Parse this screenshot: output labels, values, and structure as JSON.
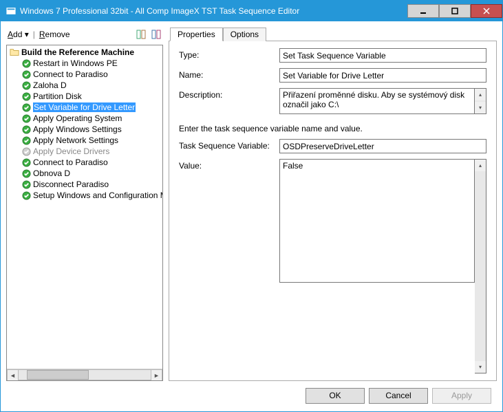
{
  "titlebar": {
    "title": "Windows 7 Professional 32bit - All Comp ImageX TST Task Sequence Editor"
  },
  "toolbar": {
    "add": "Add",
    "remove": "Remove"
  },
  "tree": {
    "root": "Build the Reference Machine",
    "items": [
      {
        "label": "Restart in Windows PE",
        "status": "ok",
        "disabled": false
      },
      {
        "label": "Connect to Paradiso",
        "status": "ok",
        "disabled": false
      },
      {
        "label": "Zaloha D",
        "status": "ok",
        "disabled": false
      },
      {
        "label": "Partition Disk",
        "status": "ok",
        "disabled": false
      },
      {
        "label": "Set Variable for Drive Letter",
        "status": "ok",
        "disabled": false,
        "selected": true
      },
      {
        "label": "Apply Operating System",
        "status": "ok",
        "disabled": false
      },
      {
        "label": "Apply Windows Settings",
        "status": "ok",
        "disabled": false
      },
      {
        "label": "Apply Network Settings",
        "status": "ok",
        "disabled": false
      },
      {
        "label": "Apply Device Drivers",
        "status": "skip",
        "disabled": true
      },
      {
        "label": "Connect to Paradiso",
        "status": "ok",
        "disabled": false
      },
      {
        "label": "Obnova D",
        "status": "ok",
        "disabled": false
      },
      {
        "label": "Disconnect Paradiso",
        "status": "ok",
        "disabled": false
      },
      {
        "label": "Setup Windows and Configuration Manager",
        "status": "ok",
        "disabled": false
      }
    ]
  },
  "tabs": {
    "properties": "Properties",
    "options": "Options"
  },
  "properties": {
    "type_label": "Type:",
    "type_value": "Set Task Sequence Variable",
    "name_label": "Name:",
    "name_value": "Set Variable for Drive Letter",
    "desc_label": "Description:",
    "desc_value": "Přiřazení proměnné disku. Aby se systémový disk označil jako C:\\",
    "instruction": "Enter the task sequence variable name and value.",
    "tsvar_label": "Task Sequence Variable:",
    "tsvar_value": "OSDPreserveDriveLetter",
    "value_label": "Value:",
    "value_value": "False"
  },
  "buttons": {
    "ok": "OK",
    "cancel": "Cancel",
    "apply": "Apply"
  }
}
